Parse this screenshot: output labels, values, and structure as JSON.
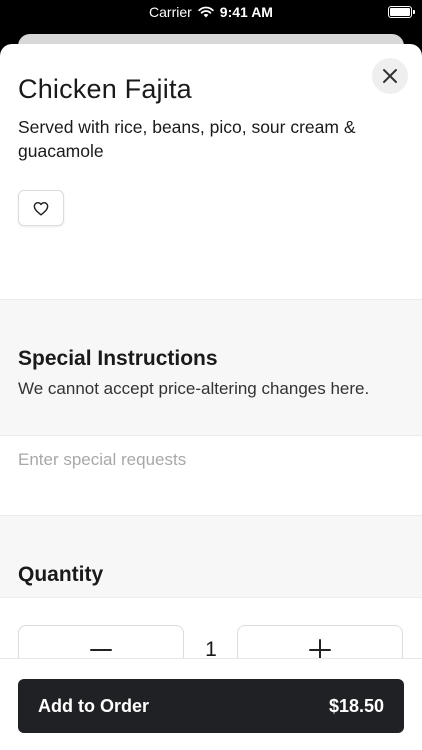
{
  "status_bar": {
    "carrier": "Carrier",
    "time": "9:41 AM",
    "icons": [
      "wifi-icon",
      "battery-icon"
    ]
  },
  "item": {
    "title": "Chicken Fajita",
    "description": "Served with rice, beans, pico, sour cream & guacamole",
    "favorite_icon": "heart-icon",
    "close_icon": "close-icon"
  },
  "special_instructions": {
    "heading": "Special Instructions",
    "subtext": "We cannot accept price-altering changes here.",
    "input_value": "",
    "input_placeholder": "Enter special requests"
  },
  "quantity": {
    "heading": "Quantity",
    "value": "1",
    "decrement_icon": "minus-icon",
    "increment_icon": "plus-icon"
  },
  "order": {
    "button_label": "Add to Order",
    "price": "$18.50"
  },
  "colors": {
    "button_bg": "#202124",
    "section_bg": "#f7f7f7",
    "placeholder": "#a8a8a8"
  }
}
